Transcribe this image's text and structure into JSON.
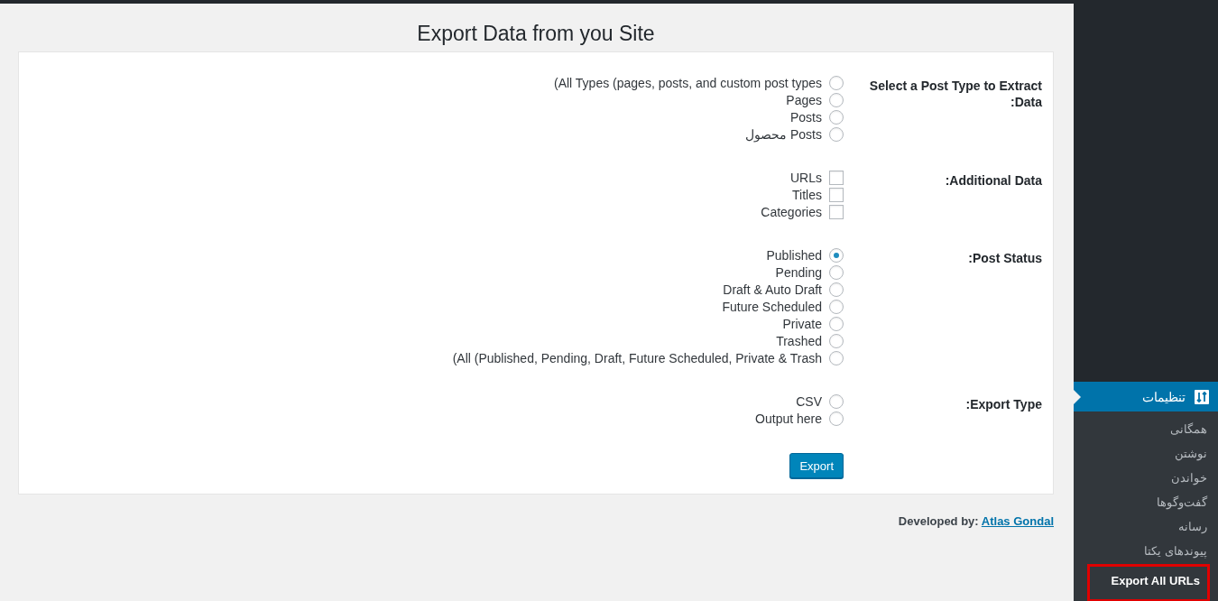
{
  "page_title": "Export Data from you Site",
  "sections": [
    {
      "label": "Select a Post Type to Extract :Data",
      "kind": "radio",
      "options": [
        {
          "label": "(All Types (pages, posts, and custom post types",
          "selected": false
        },
        {
          "label": "Pages",
          "selected": false
        },
        {
          "label": "Posts",
          "selected": false
        },
        {
          "label": "محصول Posts",
          "selected": false
        }
      ]
    },
    {
      "label": ":Additional Data",
      "kind": "checkbox",
      "options": [
        {
          "label": "URLs",
          "checked": false
        },
        {
          "label": "Titles",
          "checked": false
        },
        {
          "label": "Categories",
          "checked": false
        }
      ]
    },
    {
      "label": ":Post Status",
      "kind": "radio",
      "options": [
        {
          "label": "Published",
          "selected": true
        },
        {
          "label": "Pending",
          "selected": false
        },
        {
          "label": "Draft & Auto Draft",
          "selected": false
        },
        {
          "label": "Future Scheduled",
          "selected": false
        },
        {
          "label": "Private",
          "selected": false
        },
        {
          "label": "Trashed",
          "selected": false
        },
        {
          "label": "(All (Published, Pending, Draft, Future Scheduled, Private & Trash",
          "selected": false
        }
      ]
    },
    {
      "label": ":Export Type",
      "kind": "radio",
      "options": [
        {
          "label": "CSV",
          "selected": false
        },
        {
          "label": "Output here",
          "selected": false
        }
      ]
    }
  ],
  "export_button": "Export",
  "footer": {
    "text": "Developed by:",
    "link": "Atlas Gondal"
  },
  "sidebar": {
    "menu": {
      "label": "تنظیمات",
      "selected": true
    },
    "submenu": [
      {
        "label": "همگانی",
        "selected": false,
        "highlighted": false
      },
      {
        "label": "نوشتن",
        "selected": false,
        "highlighted": false
      },
      {
        "label": "خواندن",
        "selected": false,
        "highlighted": false
      },
      {
        "label": "گفت‌وگوها",
        "selected": false,
        "highlighted": false
      },
      {
        "label": "رسانه",
        "selected": false,
        "highlighted": false
      },
      {
        "label": "پیوندهای یکتا",
        "selected": false,
        "highlighted": false
      },
      {
        "label": "Export All URLs",
        "selected": true,
        "highlighted": true
      }
    ]
  }
}
